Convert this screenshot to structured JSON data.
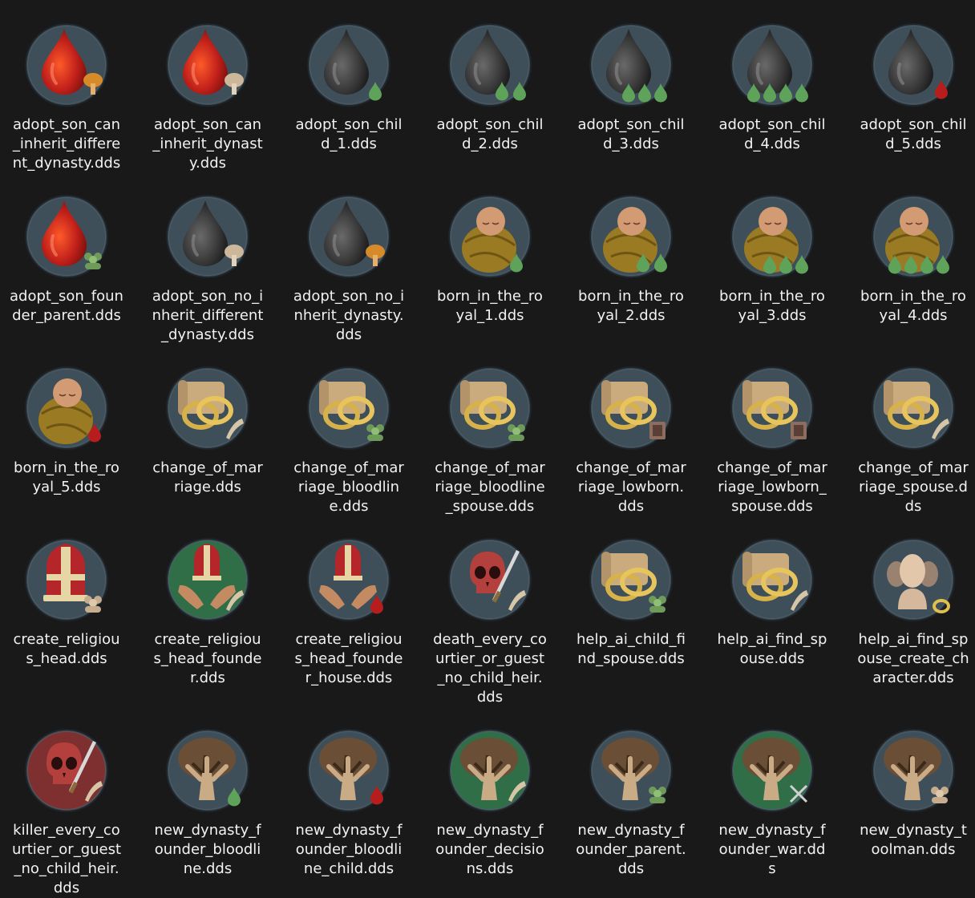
{
  "colors": {
    "background": "#191919",
    "disc_slate": "#3e4f5a",
    "disc_green": "#2f6e47",
    "disc_red": "#7e2f2f",
    "blood_red": "#c0201a",
    "ink_black": "#3a3a3a",
    "drop_green": "#5fa35a",
    "swaddle": "#9a7a22"
  },
  "files": [
    {
      "name": "adopt_son_can_inherit_different_dynasty.dds",
      "icon": "red-drop-icon",
      "badge": "tree-badge-orange"
    },
    {
      "name": "adopt_son_can_inherit_dynasty.dds",
      "icon": "red-drop-icon",
      "badge": "tree-badge-beige"
    },
    {
      "name": "adopt_son_child_1.dds",
      "icon": "black-drop-icon",
      "badge": "green-drops-1"
    },
    {
      "name": "adopt_son_child_2.dds",
      "icon": "black-drop-icon",
      "badge": "green-drops-2"
    },
    {
      "name": "adopt_son_child_3.dds",
      "icon": "black-drop-icon",
      "badge": "green-drops-3"
    },
    {
      "name": "adopt_son_child_4.dds",
      "icon": "black-drop-icon",
      "badge": "green-drops-4"
    },
    {
      "name": "adopt_son_child_5.dds",
      "icon": "black-drop-icon",
      "badge": "red-drop-badge"
    },
    {
      "name": "adopt_son_founder_parent.dds",
      "icon": "red-drop-icon",
      "badge": "people-badge-green"
    },
    {
      "name": "adopt_son_no_inherit_different_dynasty.dds",
      "icon": "black-drop-icon",
      "badge": "tree-badge-beige"
    },
    {
      "name": "adopt_son_no_inherit_dynasty.dds",
      "icon": "black-drop-icon",
      "badge": "tree-badge-orange"
    },
    {
      "name": "born_in_the_royal_1.dds",
      "icon": "baby-icon",
      "badge": "green-drops-1"
    },
    {
      "name": "born_in_the_royal_2.dds",
      "icon": "baby-icon",
      "badge": "green-drops-2"
    },
    {
      "name": "born_in_the_royal_3.dds",
      "icon": "baby-icon",
      "badge": "green-drops-3"
    },
    {
      "name": "born_in_the_royal_4.dds",
      "icon": "baby-icon",
      "badge": "green-drops-4"
    },
    {
      "name": "born_in_the_royal_5.dds",
      "icon": "baby-icon",
      "badge": "red-drop-badge"
    },
    {
      "name": "change_of_marriage.dds",
      "icon": "rings-scroll-icon",
      "badge": "quill-badge"
    },
    {
      "name": "change_of_marriage_bloodline.dds",
      "icon": "rings-scroll-icon",
      "badge": "people-badge-green"
    },
    {
      "name": "change_of_marriage_bloodline_spouse.dds",
      "icon": "rings-scroll-icon",
      "badge": "people-badge-green"
    },
    {
      "name": "change_of_marriage_lowborn.dds",
      "icon": "rings-scroll-icon",
      "badge": "frame-badge"
    },
    {
      "name": "change_of_marriage_lowborn_spouse.dds",
      "icon": "rings-scroll-icon",
      "badge": "frame-badge"
    },
    {
      "name": "change_of_marriage_spouse.dds",
      "icon": "rings-scroll-icon",
      "badge": "quill-badge"
    },
    {
      "name": "create_religious_head.dds",
      "icon": "mitre-icon",
      "badge": "people-badge-beige"
    },
    {
      "name": "create_religious_head_founder.dds",
      "icon": "mitre-hands-icon",
      "badge": "quill-badge",
      "disc": "green"
    },
    {
      "name": "create_religious_head_founder_house.dds",
      "icon": "mitre-hands-icon",
      "badge": "red-drop-badge"
    },
    {
      "name": "death_every_courtier_or_guest_no_child_heir.dds",
      "icon": "skull-dagger-icon",
      "badge": "quill-badge"
    },
    {
      "name": "help_ai_child_find_spouse.dds",
      "icon": "rings-scroll-icon",
      "badge": "people-badge-green"
    },
    {
      "name": "help_ai_find_spouse.dds",
      "icon": "rings-scroll-icon",
      "badge": "quill-badge"
    },
    {
      "name": "help_ai_find_spouse_create_character.dds",
      "icon": "busts-icon",
      "badge": "ring-badge"
    },
    {
      "name": "killer_every_courtier_or_guest_no_child_heir.dds",
      "icon": "skull-dagger-icon",
      "badge": "quill-badge",
      "disc": "red"
    },
    {
      "name": "new_dynasty_founder_bloodline.dds",
      "icon": "tree-icon",
      "badge": "green-drops-1"
    },
    {
      "name": "new_dynasty_founder_bloodline_child.dds",
      "icon": "tree-icon",
      "badge": "red-drop-badge"
    },
    {
      "name": "new_dynasty_founder_decisions.dds",
      "icon": "tree-icon",
      "badge": "quill-badge",
      "disc": "green"
    },
    {
      "name": "new_dynasty_founder_parent.dds",
      "icon": "tree-icon",
      "badge": "people-badge-green"
    },
    {
      "name": "new_dynasty_founder_war.dds",
      "icon": "tree-icon",
      "badge": "swords-badge",
      "disc": "green"
    },
    {
      "name": "new_dynasty_toolman.dds",
      "icon": "tree-icon",
      "badge": "people-badge-beige"
    }
  ]
}
